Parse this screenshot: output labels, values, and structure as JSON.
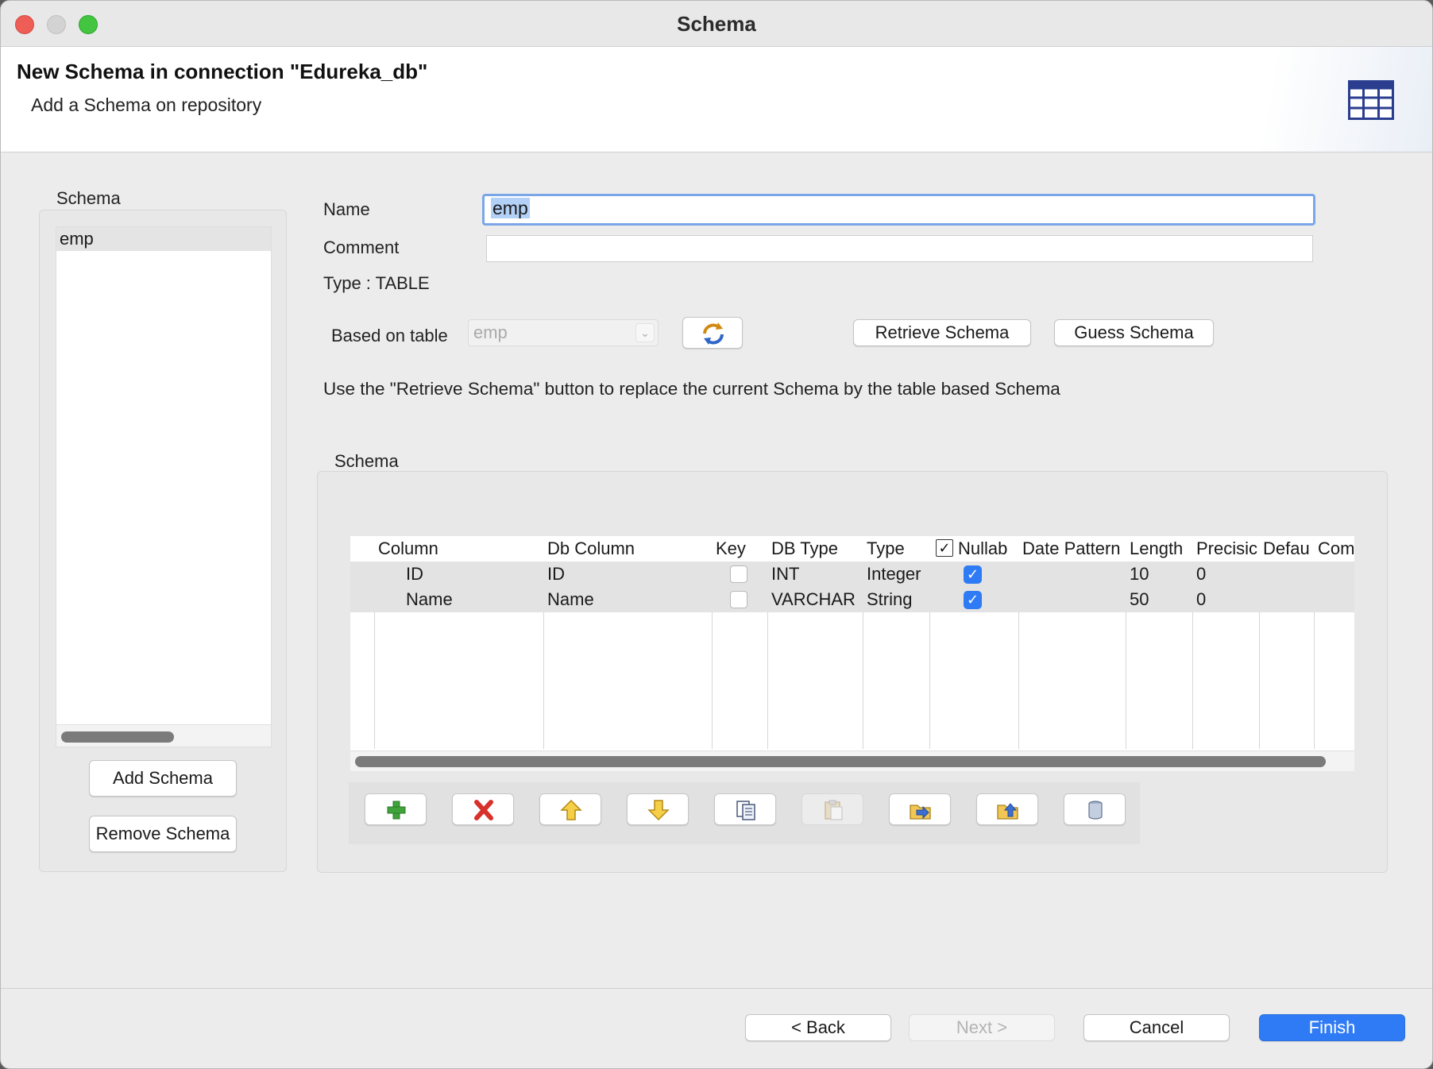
{
  "window": {
    "title": "Schema"
  },
  "header": {
    "title": "New Schema in connection \"Edureka_db\"",
    "subtitle": "Add a Schema on repository"
  },
  "left_panel": {
    "label": "Schema",
    "items": [
      "emp"
    ],
    "add_button": "Add Schema",
    "remove_button": "Remove Schema"
  },
  "form": {
    "name_label": "Name",
    "name_value": "emp",
    "comment_label": "Comment",
    "comment_value": "",
    "type_text": "Type : TABLE",
    "based_on_label": "Based on table",
    "based_on_value": "emp",
    "retrieve_button": "Retrieve Schema",
    "guess_button": "Guess Schema",
    "hint": "Use the \"Retrieve Schema\" button to replace the current Schema by the table based Schema"
  },
  "schema_table": {
    "group_label": "Schema",
    "headers": [
      "Column",
      "Db Column",
      "Key",
      "DB Type",
      "Type",
      "Nullab",
      "Date Pattern",
      "Length",
      "Precisic",
      "Defau",
      "Com"
    ],
    "rows": [
      {
        "column": "ID",
        "db_column": "ID",
        "key": false,
        "db_type": "INT",
        "type": "Integer",
        "nullable": true,
        "date_pattern": "",
        "length": "10",
        "precision": "0",
        "default": "",
        "comment": ""
      },
      {
        "column": "Name",
        "db_column": "Name",
        "key": false,
        "db_type": "VARCHAR",
        "type": "String",
        "nullable": true,
        "date_pattern": "",
        "length": "50",
        "precision": "0",
        "default": "",
        "comment": ""
      }
    ],
    "toolbar_icons": [
      "add-icon",
      "remove-icon",
      "move-up-icon",
      "move-down-icon",
      "copy-icon",
      "paste-icon",
      "import-icon",
      "export-icon",
      "database-icon"
    ]
  },
  "footer": {
    "back": "< Back",
    "next": "Next >",
    "cancel": "Cancel",
    "finish": "Finish"
  },
  "colors": {
    "accent": "#2f7bf5",
    "focus_ring": "#7aa6e8"
  }
}
